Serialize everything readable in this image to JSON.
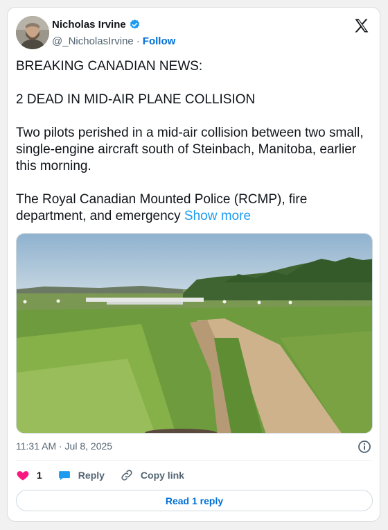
{
  "author": {
    "name": "Nicholas Irvine",
    "handle": "@_NicholasIrvine",
    "separator": "·",
    "follow_label": "Follow"
  },
  "tweet": {
    "paragraphs": [
      "BREAKING CANADIAN NEWS:",
      "2 DEAD IN MID-AIR PLANE COLLISION",
      "Two pilots perished in a mid-air collision between two small, single-engine aircraft south of Steinbach, Manitoba, earlier this morning."
    ],
    "last_paragraph": "The Royal Canadian Mounted Police (RCMP), fire department, and emergency",
    "show_more_label": "Show more"
  },
  "meta": {
    "timestamp": "11:31 AM · Jul 8, 2025"
  },
  "actions": {
    "like_count": "1",
    "reply_label": "Reply",
    "copy_link_label": "Copy link"
  },
  "read_reply_label": "Read 1 reply",
  "icons": {
    "verified": "verified-badge-icon",
    "x_logo": "x-logo-icon",
    "info": "info-icon",
    "like": "heart-icon",
    "reply": "speech-bubble-icon",
    "copy_link": "link-icon"
  },
  "colors": {
    "accent": "#1d9bf0",
    "follow": "#006fd6",
    "like": "#f91880",
    "muted": "#536471"
  }
}
